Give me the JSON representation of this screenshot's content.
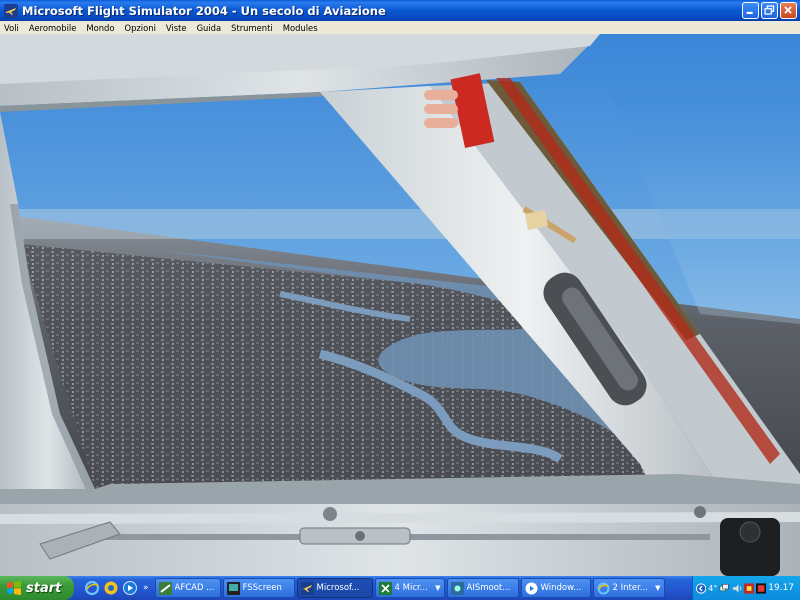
{
  "window": {
    "title": "Microsoft Flight Simulator 2004 - Un secolo di Aviazione"
  },
  "menu": {
    "items": [
      "Voli",
      "Aeromobile",
      "Mondo",
      "Opzioni",
      "Viste",
      "Guida",
      "Strumenti",
      "Modules"
    ]
  },
  "taskbar": {
    "start_label": "start",
    "quicklaunch_more": "»",
    "tasks": [
      {
        "label": "AFCAD ...",
        "icon": "afcad-icon",
        "active": false,
        "grouped": false
      },
      {
        "label": "FSScreen",
        "icon": "fsscreen-icon",
        "active": false,
        "grouped": false
      },
      {
        "label": "Microsof...",
        "icon": "fs-plane-icon",
        "active": true,
        "grouped": false
      },
      {
        "label": "4 Micr...",
        "icon": "excel-icon",
        "active": false,
        "grouped": true
      },
      {
        "label": "AISmoot...",
        "icon": "aismooth-icon",
        "active": false,
        "grouped": false
      },
      {
        "label": "Window...",
        "icon": "media-icon",
        "active": false,
        "grouped": false
      },
      {
        "label": "2 Inter...",
        "icon": "ie-icon",
        "active": false,
        "grouped": true
      }
    ],
    "tray": {
      "temperature": "4°",
      "clock": "19.17"
    }
  },
  "colors": {
    "title_bar": "#0a58d0",
    "menu_bar": "#ece9d8",
    "taskbar": "#2356d0",
    "start_button": "#3a9a3a",
    "tray": "#0d8bdc",
    "sky": "#5aa0dc",
    "frame": "#c6ced4"
  }
}
